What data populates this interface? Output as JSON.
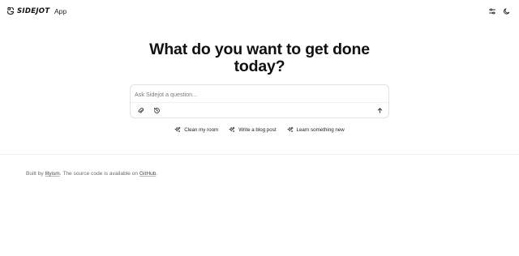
{
  "header": {
    "brand_name": "SIDEJOT",
    "brand_icon": "sidejot-logo-icon",
    "nav_app_label": "App",
    "settings_icon": "sliders-icon",
    "theme_icon": "moon-icon"
  },
  "hero": {
    "title_line1": "What do you want to get done",
    "title_line2": "today?"
  },
  "prompt": {
    "placeholder": "Ask Sidejot a question...",
    "value": "",
    "attach_icon": "paperclip-icon",
    "history_icon": "history-icon",
    "send_icon": "arrow-up-icon"
  },
  "suggestions": [
    {
      "label": "Clean my room",
      "icon": "sparkle-icon"
    },
    {
      "label": "Write a blog post",
      "icon": "sparkle-icon"
    },
    {
      "label": "Learn something new",
      "icon": "sparkle-icon"
    }
  ],
  "footer": {
    "prefix": "Built by ",
    "author_link": "Illyism",
    "middle": ". The source code is available on ",
    "source_link": "GitHub",
    "suffix": "."
  }
}
